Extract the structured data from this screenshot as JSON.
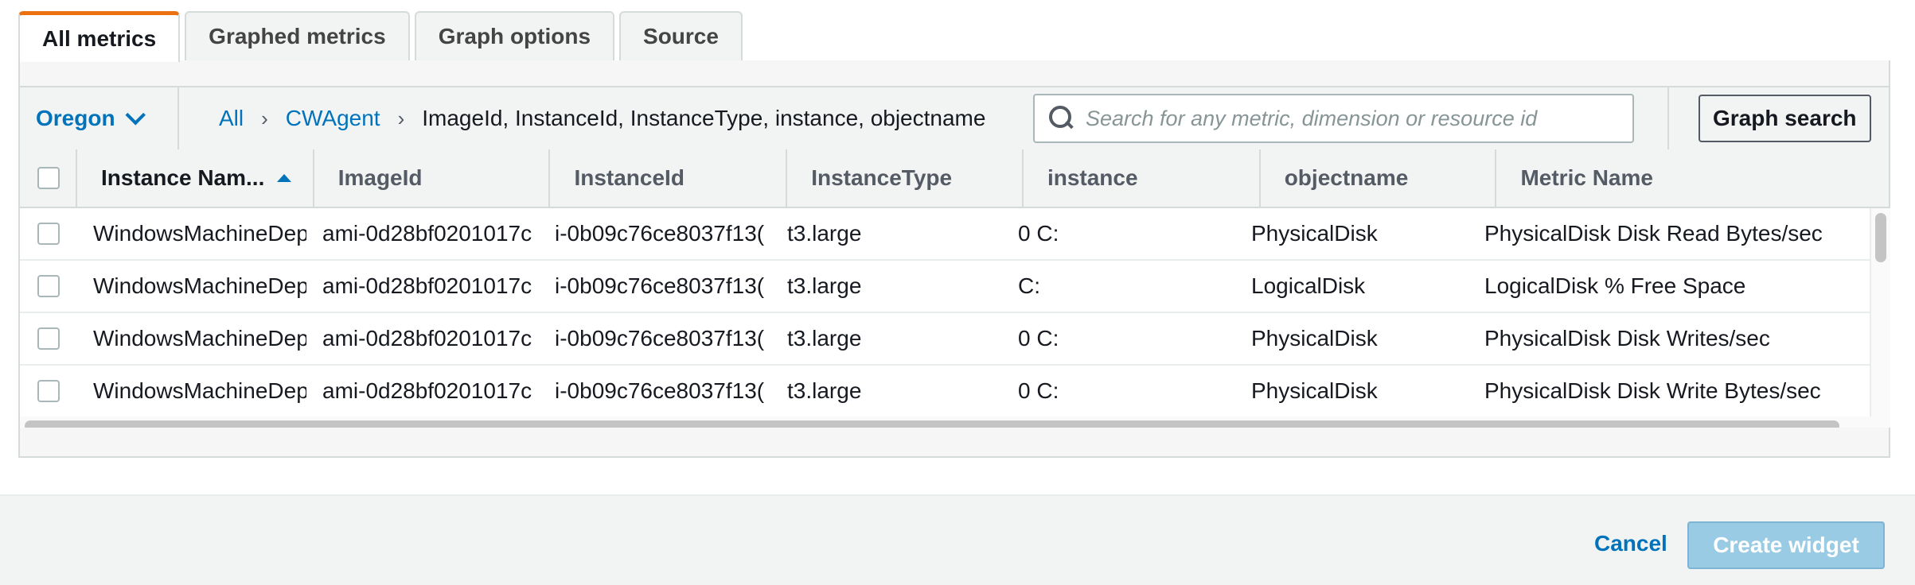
{
  "tabs": [
    {
      "label": "All metrics",
      "active": true
    },
    {
      "label": "Graphed metrics",
      "active": false
    },
    {
      "label": "Graph options",
      "active": false
    },
    {
      "label": "Source",
      "active": false
    }
  ],
  "toolbar": {
    "region": "Oregon",
    "breadcrumb": {
      "all": "All",
      "namespace": "CWAgent",
      "current": "ImageId, InstanceId, InstanceType, instance, objectname",
      "separator": "›"
    },
    "search_placeholder": "Search for any metric, dimension or resource id",
    "search_value": "",
    "graph_search_label": "Graph search"
  },
  "table": {
    "columns": [
      "Instance Nam...",
      "ImageId",
      "InstanceId",
      "InstanceType",
      "instance",
      "objectname",
      "Metric Name"
    ],
    "sorted_column": "Instance Nam...",
    "sort_direction": "ascending",
    "rows": [
      [
        "WindowsMachineDep",
        "ami-0d28bf0201017c",
        "i-0b09c76ce8037f13(",
        "t3.large",
        "0 C:",
        "PhysicalDisk",
        "PhysicalDisk Disk Read Bytes/sec"
      ],
      [
        "WindowsMachineDep",
        "ami-0d28bf0201017c",
        "i-0b09c76ce8037f13(",
        "t3.large",
        "C:",
        "LogicalDisk",
        "LogicalDisk % Free Space"
      ],
      [
        "WindowsMachineDep",
        "ami-0d28bf0201017c",
        "i-0b09c76ce8037f13(",
        "t3.large",
        "0 C:",
        "PhysicalDisk",
        "PhysicalDisk Disk Writes/sec"
      ],
      [
        "WindowsMachineDep",
        "ami-0d28bf0201017c",
        "i-0b09c76ce8037f13(",
        "t3.large",
        "0 C:",
        "PhysicalDisk",
        "PhysicalDisk Disk Write Bytes/sec"
      ]
    ]
  },
  "footer": {
    "cancel_label": "Cancel",
    "create_label": "Create widget"
  },
  "colors": {
    "accent": "#0073bb",
    "active_tab_border": "#ec7211",
    "disabled_primary": "#99cbe4"
  }
}
